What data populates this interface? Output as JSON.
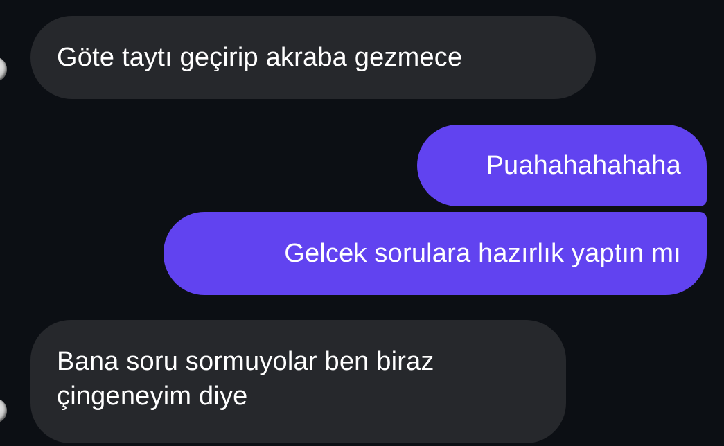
{
  "messages": [
    {
      "side": "incoming",
      "text": "Göte taytı geçirip akraba gezmece"
    },
    {
      "side": "outgoing",
      "text": "Puahahahahaha"
    },
    {
      "side": "outgoing",
      "text": "Gelcek sorulara hazırlık yaptın mı"
    },
    {
      "side": "incoming",
      "lines": [
        "Bana soru sormuyolar ben biraz",
        "çingeneyim diye"
      ]
    }
  ],
  "colors": {
    "background": "#0c0f14",
    "incoming_bubble": "#26282c",
    "outgoing_bubble": "#6143f0",
    "text": "#ffffff"
  },
  "icons": {
    "avatar": "contact-avatar-icon"
  }
}
